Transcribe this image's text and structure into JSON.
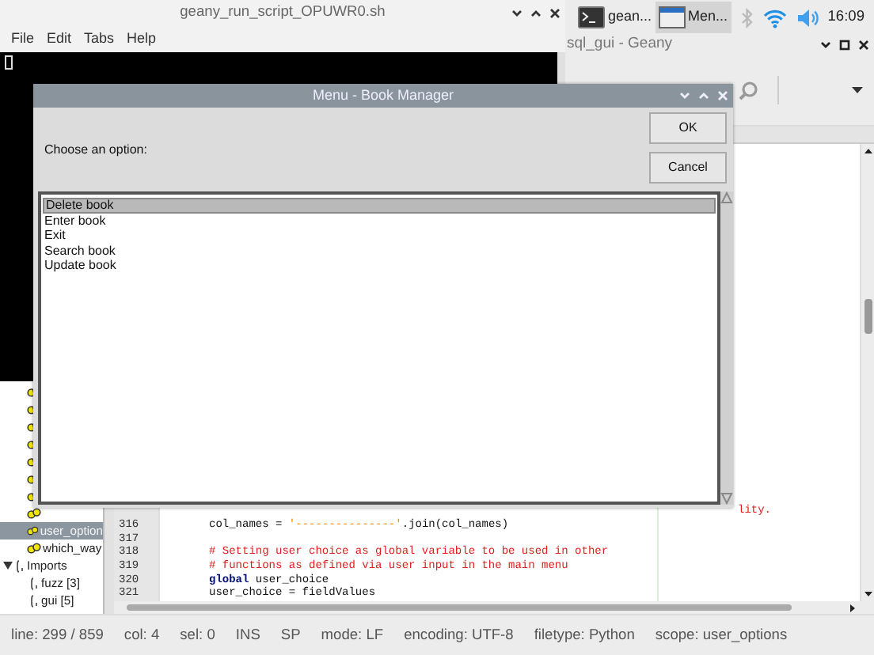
{
  "taskbar": {
    "tasks": [
      {
        "label": "gean...",
        "kind": "terminal",
        "selected": false
      },
      {
        "label": "Men...",
        "kind": "window",
        "selected": true
      }
    ],
    "clock": "16:09"
  },
  "terminal_window": {
    "title": "geany_run_script_OPUWR0.sh",
    "menu": [
      "File",
      "Edit",
      "Tabs",
      "Help"
    ]
  },
  "geany_window": {
    "title": "sql_gui - Geany",
    "symbols": [
      {
        "label": "user_option",
        "selected": true
      },
      {
        "label": "which_way",
        "selected": false
      }
    ],
    "imports": {
      "label": "Imports",
      "expanded": true,
      "children": [
        {
          "label": "fuzz [3]"
        },
        {
          "label": "gui [5]"
        }
      ]
    },
    "overflow_text": "lity.",
    "code_lines": [
      {
        "number": "316",
        "segments": [
          {
            "kind": "plain",
            "text": "col_names = "
          },
          {
            "kind": "string",
            "text": "'---------------'"
          },
          {
            "kind": "plain",
            "text": ".join(col_names)"
          }
        ]
      },
      {
        "number": "317"
      },
      {
        "number": "318",
        "segments": [
          {
            "kind": "comment",
            "text": "# Setting user choice as global variable to be used in other"
          }
        ]
      },
      {
        "number": "319",
        "segments": [
          {
            "kind": "comment",
            "text": "# functions as defined via user input in the main menu"
          }
        ]
      },
      {
        "number": "320",
        "segments": [
          {
            "kind": "keyword",
            "text": "global"
          },
          {
            "kind": "plain",
            "text": " user_choice"
          }
        ]
      },
      {
        "number": "321",
        "segments": [
          {
            "kind": "plain",
            "text": "user_choice = fieldValues"
          }
        ]
      }
    ],
    "status_bar": [
      "line: 299 / 859",
      "col: 4",
      "sel: 0",
      "INS",
      "SP",
      "mode: LF",
      "encoding: UTF-8",
      "filetype: Python",
      "scope: user_options"
    ]
  },
  "dialog": {
    "title": "Menu - Book Manager",
    "prompt": "Choose an option:",
    "buttons": [
      "OK",
      "Cancel"
    ],
    "options": [
      {
        "label": "Delete book",
        "selected": true
      },
      {
        "label": "Enter book",
        "selected": false
      },
      {
        "label": "Exit",
        "selected": false
      },
      {
        "label": "Search book",
        "selected": false
      },
      {
        "label": "Update book",
        "selected": false
      }
    ]
  }
}
